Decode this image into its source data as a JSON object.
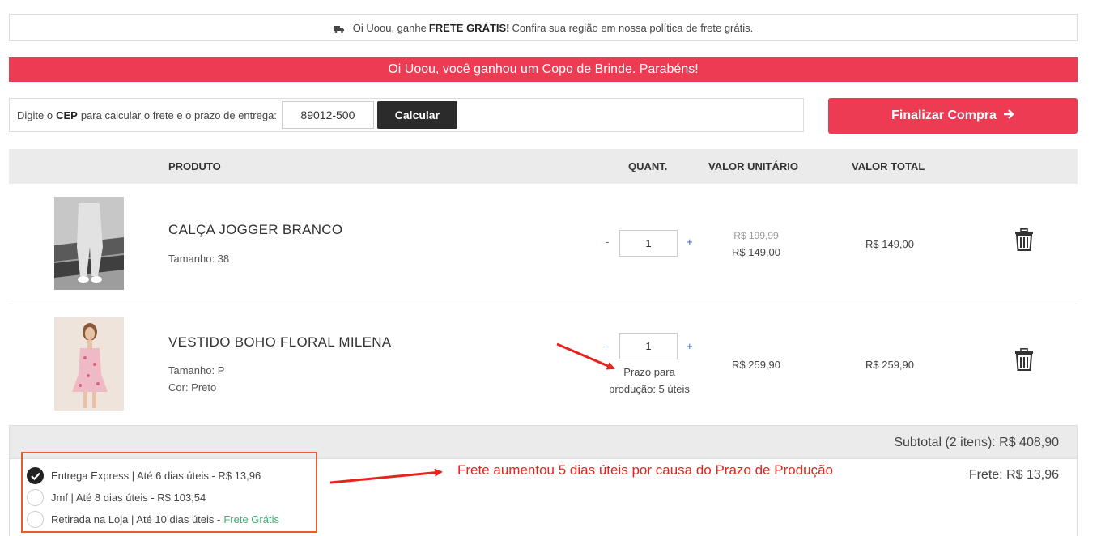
{
  "notice": {
    "prefix": "Oi Uoou, ganhe",
    "bold": "FRETE GRÁTIS!",
    "suffix": "Confira sua região em nossa política de frete grátis."
  },
  "gift_banner": "Oi Uoou, você ganhou um Copo de Brinde. Parabéns!",
  "cep": {
    "label_prefix": "Digite o",
    "label_bold": "CEP",
    "label_suffix": "para calcular o frete e o prazo de entrega:",
    "value": "89012-500",
    "button": "Calcular"
  },
  "checkout_button": "Finalizar Compra",
  "table_headers": {
    "produto": "PRODUTO",
    "quant": "QUANT.",
    "valor_unitario": "VALOR UNITÁRIO",
    "valor_total": "VALOR TOTAL"
  },
  "items": [
    {
      "name": "CALÇA JOGGER BRANCO",
      "attrs": [
        "Tamanho: 38"
      ],
      "qty": "1",
      "old_price": "R$ 199,99",
      "unit_price": "R$ 149,00",
      "total_price": "R$ 149,00"
    },
    {
      "name": "VESTIDO BOHO FLORAL MILENA",
      "attrs": [
        "Tamanho: P",
        "Cor: Preto"
      ],
      "qty": "1",
      "prazo": [
        "Prazo para",
        "produção: 5 úteis"
      ],
      "unit_price": "R$ 259,90",
      "total_price": "R$ 259,90"
    }
  ],
  "qty_minus": "-",
  "qty_plus": "+",
  "subtotal": "Subtotal (2 itens): R$ 408,90",
  "shipping_options": [
    {
      "label": "Entrega Express | Até 6 dias úteis - R$ 13,96",
      "selected": true
    },
    {
      "label": "Jmf | Até 8 dias úteis - R$ 103,54",
      "selected": false
    },
    {
      "label": "Retirada na Loja | Até 10 dias úteis -",
      "free": "Frete Grátis",
      "selected": false
    }
  ],
  "frete_total": "Frete: R$ 13,96",
  "annotation": "Frete aumentou 5 dias úteis por causa do Prazo de Produção",
  "colors": {
    "accent": "#ee3b54",
    "dark_button": "#2b2b2b",
    "annotation": "#e8231d",
    "highlight_box": "#e95a2d",
    "free_shipping": "#3cb371"
  }
}
